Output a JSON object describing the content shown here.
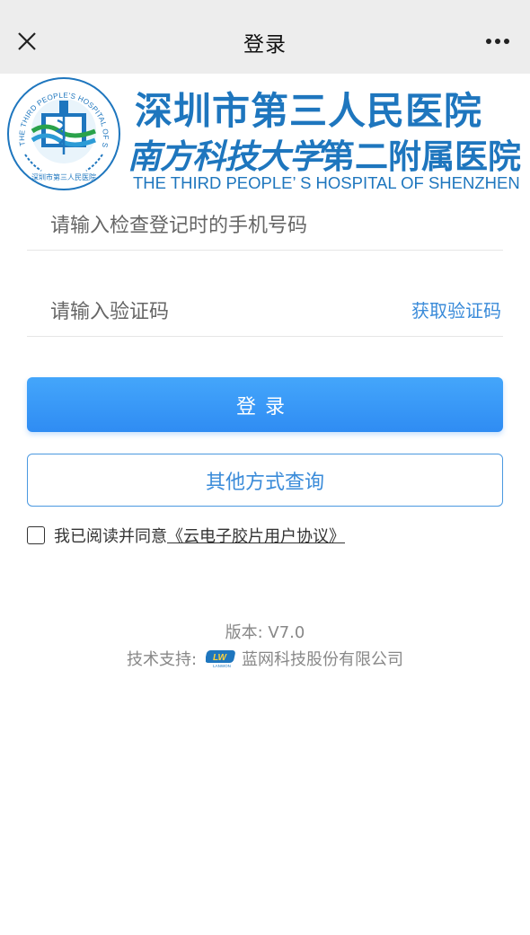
{
  "titlebar": {
    "title": "登录",
    "close_icon": "close-icon",
    "more_icon": "more-icon"
  },
  "banner": {
    "hospital_name_cn": "深圳市第三人民医院",
    "university_name_script": "南方科技大学",
    "university_suffix": "第二附属医院",
    "hospital_name_en": "THE THIRD PEOPLE’ S HOSPITAL OF SHENZHEN",
    "seal_text_en": "THE THIRD PEOPLE'S HOSPITAL OF SHENZHEN",
    "seal_text_cn": "深圳市第三人民医院"
  },
  "form": {
    "phone_placeholder": "请输入检查登记时的手机号码",
    "phone_value": "",
    "code_placeholder": "请输入验证码",
    "code_value": "",
    "get_code_label": "获取验证码",
    "login_label": "登录",
    "other_query_label": "其他方式查询",
    "agree_text": "我已阅读并同意",
    "agreement_link": "《云电子胶片用户协议》",
    "agree_checked": false
  },
  "footer": {
    "version_label": "版本: V7.0",
    "support_label": "技术支持:",
    "support_company": "蓝网科技股份有限公司",
    "support_logo_text": "LANWON"
  },
  "colors": {
    "accent": "#3a8bd9",
    "button_gradient_top": "#44a6fb",
    "button_gradient_bottom": "#2f8cf3",
    "hospital_blue": "#1e76be",
    "titlebar_bg": "#ededed"
  }
}
